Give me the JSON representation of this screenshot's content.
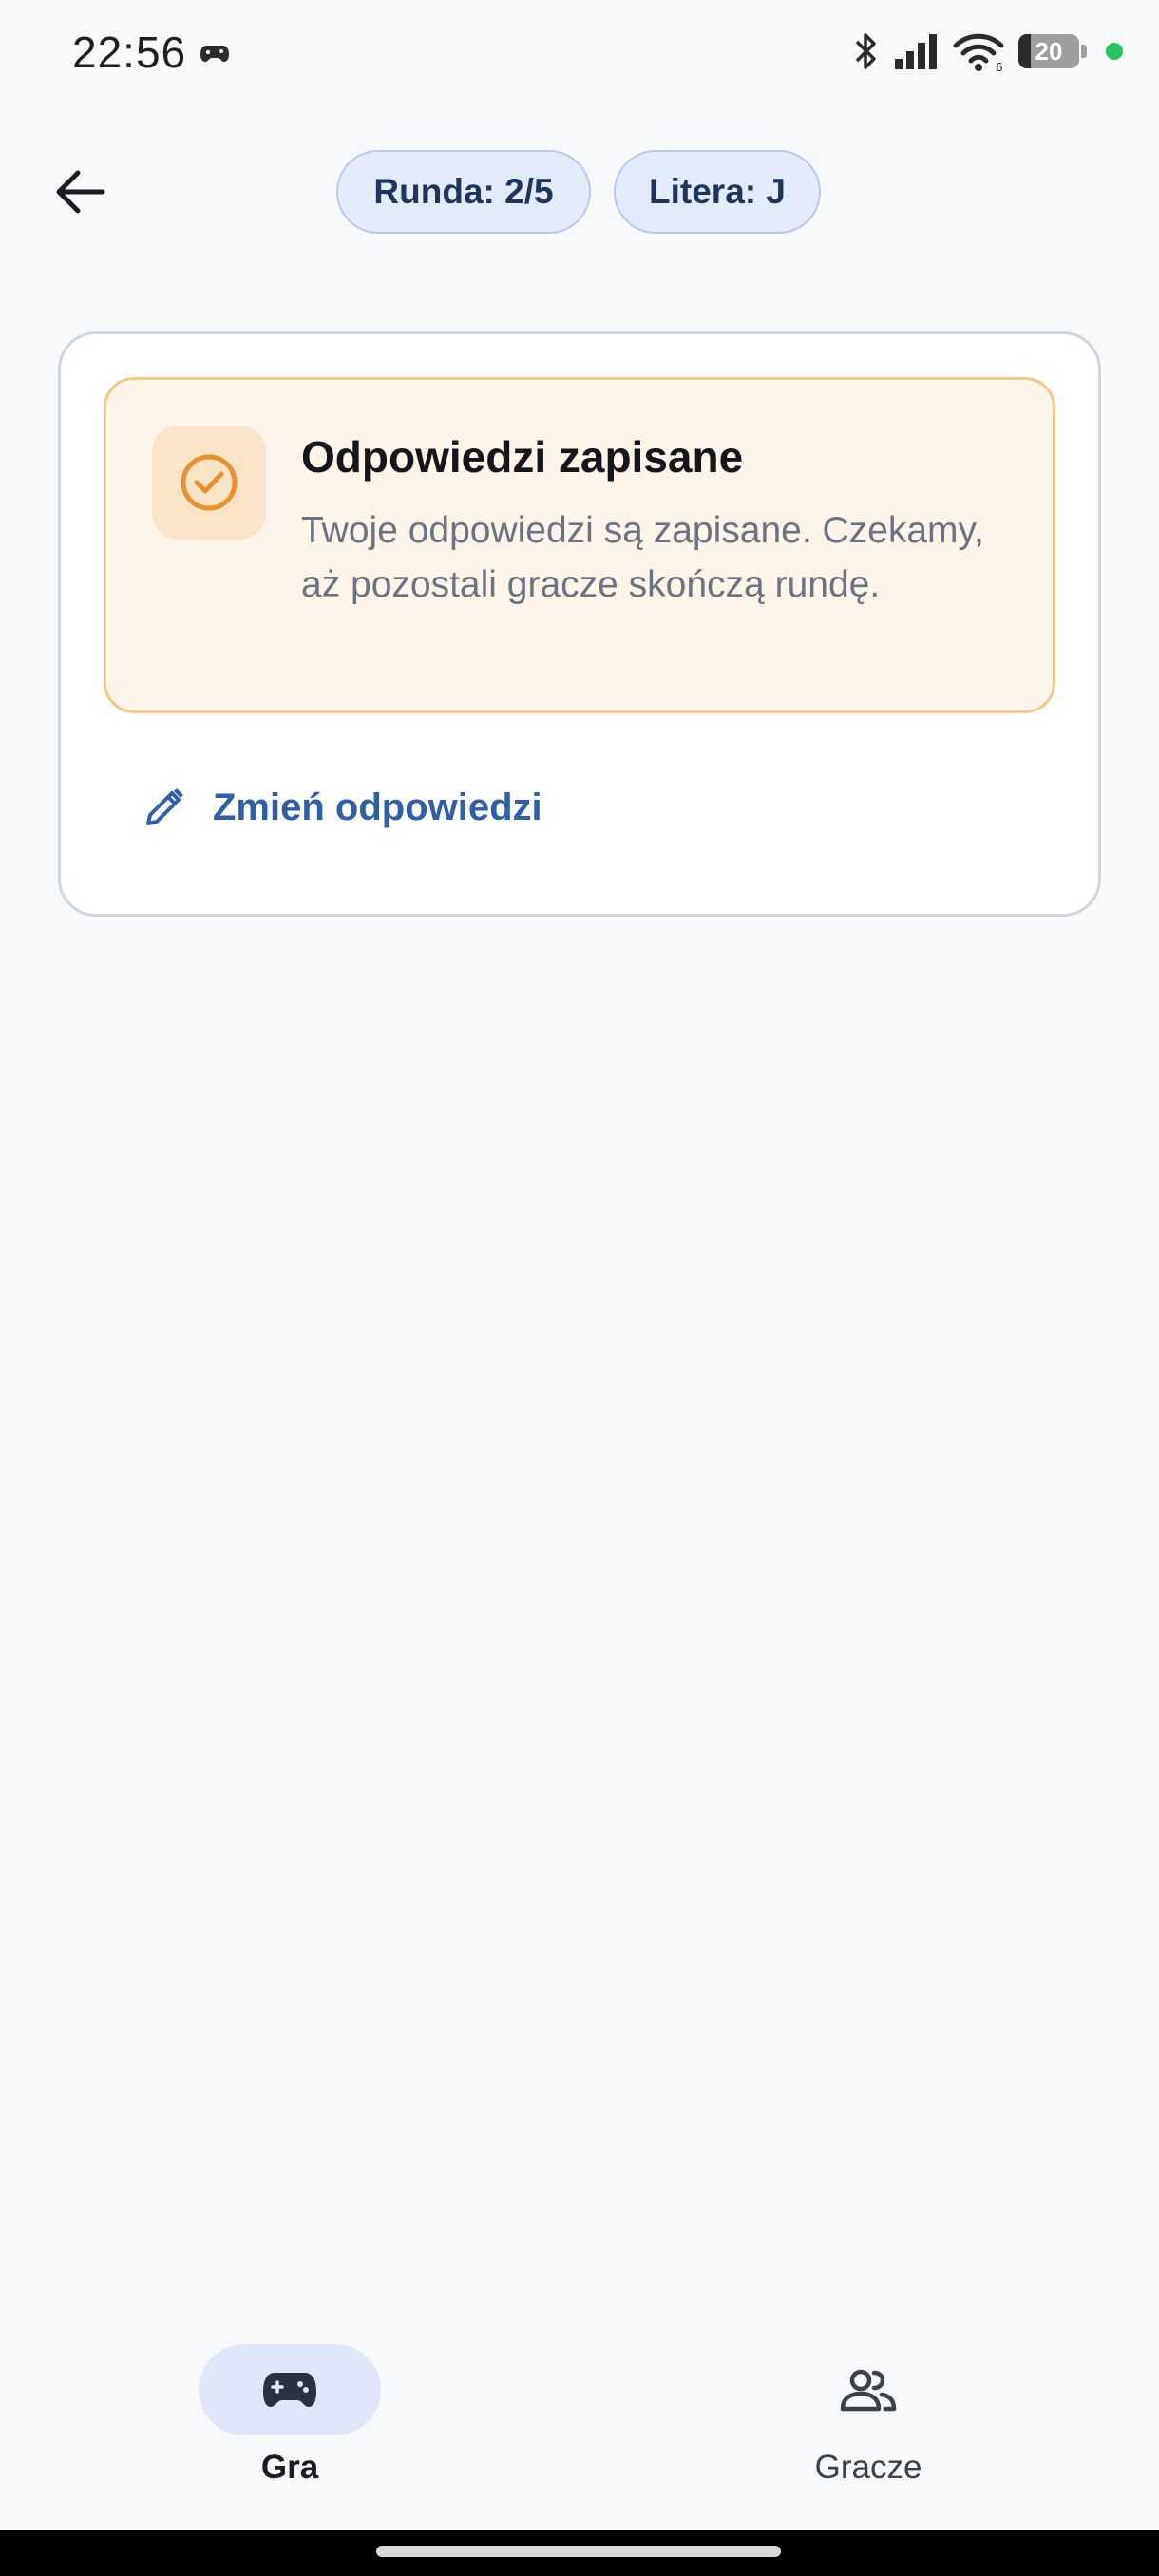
{
  "status_bar": {
    "time": "22:56",
    "battery_level": "20",
    "icons": [
      "gamepad-icon",
      "bluetooth-icon",
      "signal-icon",
      "wifi-icon",
      "battery-icon",
      "active-dot-icon"
    ],
    "accent_dot_color": "#22c55e"
  },
  "header": {
    "back_icon": "arrow-left-icon",
    "round_chip": "Runda: 2/5",
    "letter_chip": "Litera: J"
  },
  "card": {
    "notice": {
      "icon": "check-circle-icon",
      "title": "Odpowiedzi zapisane",
      "text": "Twoje odpowiedzi są zapisane. Czekamy, aż pozostali gracze skończą rundę.",
      "accent_color": "#e8902c"
    },
    "edit_button": {
      "icon": "pencil-icon",
      "label": "Zmień odpowiedzi",
      "color": "#2f5fa8"
    }
  },
  "bottom_nav": {
    "items": [
      {
        "label": "Gra",
        "icon": "gamepad-icon",
        "active": true
      },
      {
        "label": "Gracze",
        "icon": "people-icon",
        "active": false
      }
    ]
  }
}
